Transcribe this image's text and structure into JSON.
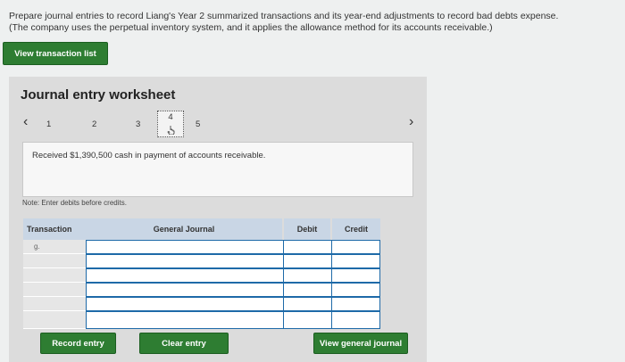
{
  "instructions": {
    "line1": "Prepare journal entries to record Liang's Year 2 summarized transactions and its year-end adjustments to record bad debts expense.",
    "line2": "(The company uses the perpetual inventory system, and it applies the allowance method for its accounts receivable.)"
  },
  "view_transaction_list_label": "View transaction list",
  "worksheet": {
    "title": "Journal entry worksheet",
    "pages": [
      "1",
      "2",
      "3",
      "4",
      "5"
    ],
    "active_page": "4",
    "prev_icon": "chevron-left-icon",
    "next_icon": "chevron-right-icon",
    "description": "Received $1,390,500 cash in payment of accounts receivable.",
    "note": "Note: Enter debits before credits.",
    "table": {
      "headers": {
        "transaction": "Transaction",
        "general_journal": "General Journal",
        "debit": "Debit",
        "credit": "Credit"
      },
      "rows": [
        {
          "transaction": "g."
        },
        {
          "transaction": ""
        },
        {
          "transaction": ""
        },
        {
          "transaction": ""
        },
        {
          "transaction": ""
        },
        {
          "transaction": ""
        }
      ]
    }
  },
  "buttons": {
    "record_entry": "Record entry",
    "clear_entry": "Clear entry",
    "view_general_journal": "View general journal"
  },
  "colors": {
    "button_green": "#2e7d32",
    "header_blue": "#c9d6e5",
    "input_border": "#1e6aa8",
    "panel_gray": "#dcdcdc"
  }
}
